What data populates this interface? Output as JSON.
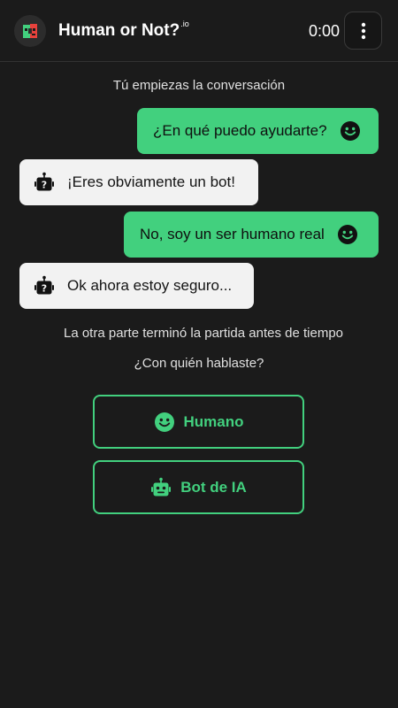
{
  "header": {
    "title": "Human or Not?",
    "title_suffix": ".io",
    "timer": "0:00",
    "logo_icon": "split-face-logo-icon",
    "menu_icon": "vertical-dots-icon"
  },
  "chat": {
    "intro": "Tú empiezas la conversación",
    "messages": [
      {
        "sender": "user",
        "text": "¿En qué puedo ayudarte?",
        "icon": "smiley-icon"
      },
      {
        "sender": "other",
        "text": "¡Eres obviamente un bot!",
        "icon": "robot-question-icon"
      },
      {
        "sender": "user",
        "text": "No, soy un ser humano real",
        "icon": "smiley-icon"
      },
      {
        "sender": "other",
        "text": "Ok ahora estoy seguro...",
        "icon": "robot-question-icon"
      }
    ],
    "ended_notice": "La otra parte terminó la partida antes de tiempo"
  },
  "guess": {
    "question": "¿Con quién hablaste?",
    "options": [
      {
        "label": "Humano",
        "icon": "smiley-icon"
      },
      {
        "label": "Bot de IA",
        "icon": "robot-icon"
      }
    ]
  },
  "colors": {
    "background": "#1b1b1b",
    "accent": "#42d07e",
    "other_bubble": "#f2f2f2",
    "logo_red": "#e8413c"
  }
}
